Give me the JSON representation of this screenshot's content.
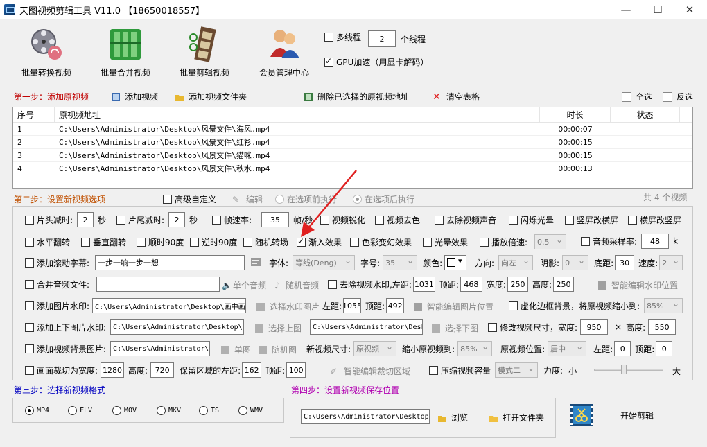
{
  "window": {
    "title": "天图视频剪辑工具 V11.0  【18650018557】",
    "min_icon": "—",
    "max_icon": "☐",
    "close_icon": "✕"
  },
  "toolbar": {
    "batch_convert": "批量转换视频",
    "batch_merge": "批量合并视频",
    "batch_edit": "批量剪辑视频",
    "member_center": "会员管理中心",
    "multithread_label": "多线程",
    "thread_count": "2",
    "thread_unit": "个线程",
    "gpu_label": "GPU加速（用显卡解码）"
  },
  "step1": {
    "title": "第一步：添加原视频",
    "add_video": "添加视频",
    "add_folder": "添加视频文件夹",
    "delete_selected": "删除已选择的原视频地址",
    "clear_table": "清空表格",
    "select_all": "全选",
    "invert": "反选"
  },
  "table": {
    "headers": [
      "序号",
      "原视频地址",
      "时长",
      "状态"
    ],
    "rows": [
      {
        "no": "1",
        "path": "C:\\Users\\Administrator\\Desktop\\风景文件\\海风.mp4",
        "duration": "00:00:07",
        "status": ""
      },
      {
        "no": "2",
        "path": "C:\\Users\\Administrator\\Desktop\\风景文件\\红衫.mp4",
        "duration": "00:00:15",
        "status": ""
      },
      {
        "no": "3",
        "path": "C:\\Users\\Administrator\\Desktop\\风景文件\\猫咪.mp4",
        "duration": "00:00:15",
        "status": ""
      },
      {
        "no": "4",
        "path": "C:\\Users\\Administrator\\Desktop\\风景文件\\秋水.mp4",
        "duration": "00:00:13",
        "status": ""
      }
    ]
  },
  "step2": {
    "title": "第二步：设置新视频选项",
    "advanced": "高级自定义",
    "edit": "编辑",
    "before_exec": "在选项前执行",
    "after_exec": "在选项后执行",
    "count": "共 4 个视频",
    "r1": {
      "head_cut": "片头减时:",
      "head_val": "2",
      "sec1": "秒",
      "tail_cut": "片尾减时:",
      "tail_val": "2",
      "sec2": "秒",
      "fps": "帧速率:",
      "fps_val": "35",
      "fps_unit": "帧/秒",
      "sharpen": "视频锐化",
      "decolor": "视频去色",
      "mute": "去除视频声音",
      "flash": "闪烁光晕",
      "v2h": "竖屏改横屏",
      "h2v": "横屏改竖屏"
    },
    "r2": {
      "hflip": "水平翻转",
      "vflip": "垂直翻转",
      "cw90": "顺时90度",
      "ccw90": "逆时90度",
      "random_trans": "随机转场",
      "fade_in": "渐入效果",
      "color_fx": "色彩变幻效果",
      "halo": "光晕效果",
      "speed": "播放倍速:",
      "speed_val": "0.5",
      "sample_rate": "音频采样率:",
      "sample_val": "48",
      "sample_unit": "k"
    },
    "r3": {
      "scroll_sub": "添加滚动字幕:",
      "sub_text": "一步一响一步一想",
      "font": "字体:",
      "font_val": "等线(Deng)",
      "size": "字号:",
      "size_val": "35",
      "color": "颜色:",
      "dir": "方向:",
      "dir_val": "向左",
      "shadow": "阴影:",
      "shadow_val": "0",
      "bottom": "底距:",
      "bottom_val": "30",
      "speed": "速度:",
      "speed_val": "2"
    },
    "r4": {
      "merge_audio": "合并音频文件:",
      "single_audio": "单个音频",
      "random_audio": "随机音频",
      "remove_wm": "去除视频水印,左距:",
      "left_val": "1031",
      "top": "顶距:",
      "top_val": "468",
      "width": "宽度:",
      "width_val": "250",
      "height": "高度:",
      "height_val": "250",
      "smart_wm": "智能编辑水印位置"
    },
    "r5": {
      "img_wm": "添加图片水印:",
      "img_path": "C:\\Users\\Administrator\\Desktop\\画中画",
      "choose_img": "选择水印图片",
      "left": "左距:",
      "left_val": "1055",
      "top": "顶距:",
      "top_val": "492",
      "smart_img": "智能编辑图片位置",
      "blur_bg": "虚化边框背景，将原视频缩小到:",
      "blur_val": "85%"
    },
    "r6": {
      "tb_wm": "添加上下图片水印:",
      "top_path": "C:\\Users\\Administrator\\Desktop\\Q",
      "choose_top": "选择上图",
      "bottom_path": "C:\\Users\\Administrator\\Desk",
      "choose_bottom": "选择下图",
      "resize": "修改视频尺寸，宽度:",
      "w_val": "950",
      "times": "×",
      "height": "高度:",
      "h_val": "550"
    },
    "r7": {
      "bg_img": "添加视频背景图片:",
      "bg_path": "C:\\Users\\Administrator\\D",
      "single_img": "单图",
      "random_img": "随机图",
      "new_size": "新视频尺寸:",
      "new_size_val": "原视频",
      "shrink": "缩小原视频到:",
      "shrink_val": "85%",
      "pos": "原视频位置:",
      "pos_val": "居中",
      "left": "左距:",
      "left_val": "0",
      "top": "顶距:",
      "top_val": "0"
    },
    "r8": {
      "crop": "画面裁切为宽度:",
      "crop_w": "1280",
      "height": "高度:",
      "crop_h": "720",
      "keep_left": "保留区域的左距:",
      "keep_left_val": "162",
      "top": "顶距:",
      "top_val": "100",
      "smart_crop": "智能编辑裁切区域",
      "compress": "压缩视频容量",
      "mode_val": "模式二",
      "strength": "力度:",
      "small": "小",
      "large": "大",
      "slider_level": 0.42
    }
  },
  "step3": {
    "title": "第三步：选择新视频格式",
    "formats": [
      "MP4",
      "FLV",
      "MOV",
      "MKV",
      "TS",
      "WMV"
    ]
  },
  "step4": {
    "title": "第四步：设置新视频保存位置",
    "save_path": "C:\\Users\\Administrator\\Desktop",
    "browse": "浏览",
    "open_folder": "打开文件夹",
    "start": "开始剪辑"
  },
  "colors": {
    "step1_title": "#c00000",
    "step2_title": "#c05000",
    "step3_title": "#0000c0",
    "step4_title": "#b000b0",
    "arrow": "#e02020"
  }
}
